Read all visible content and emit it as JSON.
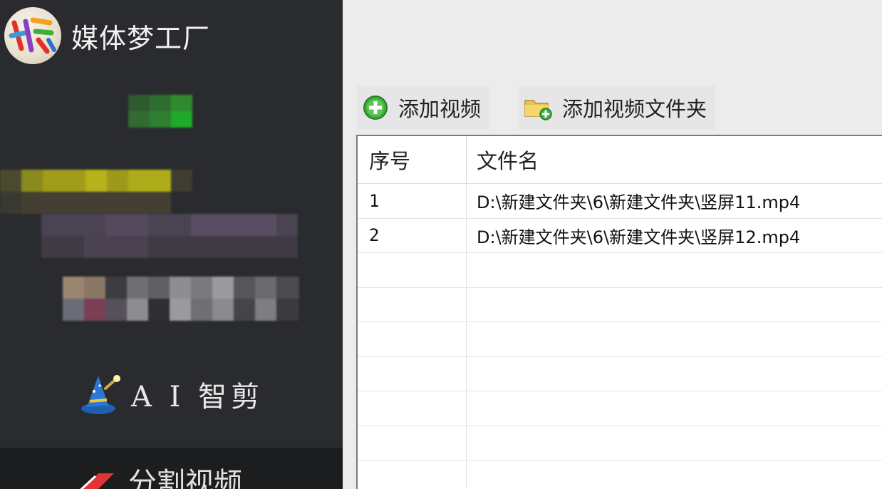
{
  "app": {
    "title": "媒体梦工厂"
  },
  "sidebar": {
    "ai_clip_label": "A I 智剪",
    "split_video_label": "分割视频"
  },
  "toolbar": {
    "add_video_label": "添加视频",
    "add_folder_label": "添加视频文件夹"
  },
  "table": {
    "headers": {
      "index": "序号",
      "filename": "文件名"
    },
    "rows": [
      {
        "index": "1",
        "filename": "D:\\新建文件夹\\6\\新建文件夹\\竖屏11.mp4"
      },
      {
        "index": "2",
        "filename": "D:\\新建文件夹\\6\\新建文件夹\\竖屏12.mp4"
      },
      {
        "index": "",
        "filename": ""
      },
      {
        "index": "",
        "filename": ""
      },
      {
        "index": "",
        "filename": ""
      },
      {
        "index": "",
        "filename": ""
      },
      {
        "index": "",
        "filename": ""
      },
      {
        "index": "",
        "filename": ""
      },
      {
        "index": "",
        "filename": ""
      }
    ]
  },
  "colors": {
    "sidebar_bg": "#2a2b2e",
    "main_bg": "#ececed",
    "accent_green": "#3fae3a"
  }
}
